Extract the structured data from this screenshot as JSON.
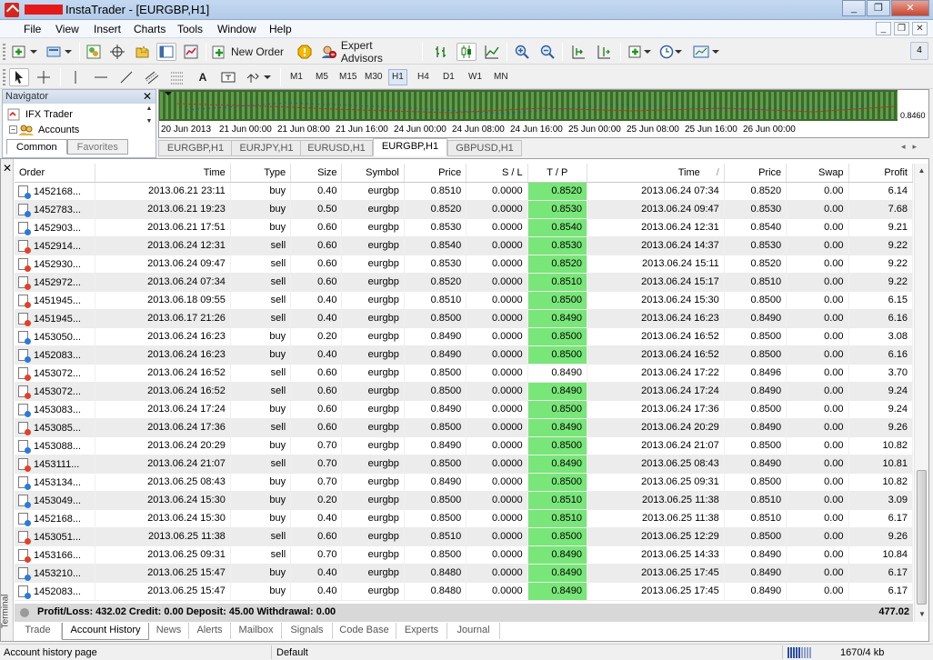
{
  "window": {
    "title": "InstaTrader - [EURGBP,H1]",
    "buttons": [
      "_",
      "❐",
      "✕"
    ]
  },
  "menu": [
    "File",
    "View",
    "Insert",
    "Charts",
    "Tools",
    "Window",
    "Help"
  ],
  "mdi_buttons": [
    "_",
    "❐",
    "✕"
  ],
  "toolbar": {
    "new_order": "New Order",
    "expert_advisors": "Expert Advisors",
    "sidebar_count": "4",
    "text_tool": "A",
    "timeframes": [
      "M1",
      "M5",
      "M15",
      "M30",
      "H1",
      "H4",
      "D1",
      "W1",
      "MN"
    ],
    "active_timeframe": "H1"
  },
  "navigator": {
    "title": "Navigator",
    "tree": [
      "IFX Trader",
      "Accounts"
    ],
    "tabs": [
      "Common",
      "Favorites"
    ]
  },
  "chart": {
    "dates": [
      "20 Jun 2013",
      "21 Jun 00:00",
      "21 Jun 08:00",
      "21 Jun 16:00",
      "24 Jun 00:00",
      "24 Jun 08:00",
      "24 Jun 16:00",
      "25 Jun 00:00",
      "25 Jun 08:00",
      "25 Jun 16:00",
      "26 Jun 00:00"
    ],
    "price_label": "0.8460",
    "tabs": [
      "EURGBP,H1",
      "EURJPY,H1",
      "EURUSD,H1",
      "EURGBP,H1",
      "GBPUSD,H1"
    ],
    "active_tab": 3
  },
  "terminal": {
    "label": "Terminal",
    "columns": [
      "Order",
      "Time",
      "Type",
      "Size",
      "Symbol",
      "Price",
      "S / L",
      "T / P",
      "Time",
      "Price",
      "Swap",
      "Profit"
    ],
    "rows": [
      {
        "order": "1452168...",
        "open_time": "2013.06.21 23:11",
        "type": "buy",
        "size": "0.40",
        "symbol": "eurgbp",
        "open_price": "0.8510",
        "sl": "0.0000",
        "tp": "0.8520",
        "close_time": "2013.06.24 07:34",
        "close_price": "0.8520",
        "swap": "0.00",
        "profit": "6.14",
        "tp_hit": true
      },
      {
        "order": "1452783...",
        "open_time": "2013.06.21 19:23",
        "type": "buy",
        "size": "0.50",
        "symbol": "eurgbp",
        "open_price": "0.8520",
        "sl": "0.0000",
        "tp": "0.8530",
        "close_time": "2013.06.24 09:47",
        "close_price": "0.8530",
        "swap": "0.00",
        "profit": "7.68",
        "tp_hit": true
      },
      {
        "order": "1452903...",
        "open_time": "2013.06.21 17:51",
        "type": "buy",
        "size": "0.60",
        "symbol": "eurgbp",
        "open_price": "0.8530",
        "sl": "0.0000",
        "tp": "0.8540",
        "close_time": "2013.06.24 12:31",
        "close_price": "0.8540",
        "swap": "0.00",
        "profit": "9.21",
        "tp_hit": true
      },
      {
        "order": "1452914...",
        "open_time": "2013.06.24 12:31",
        "type": "sell",
        "size": "0.60",
        "symbol": "eurgbp",
        "open_price": "0.8540",
        "sl": "0.0000",
        "tp": "0.8530",
        "close_time": "2013.06.24 14:37",
        "close_price": "0.8530",
        "swap": "0.00",
        "profit": "9.22",
        "tp_hit": true
      },
      {
        "order": "1452930...",
        "open_time": "2013.06.24 09:47",
        "type": "sell",
        "size": "0.60",
        "symbol": "eurgbp",
        "open_price": "0.8530",
        "sl": "0.0000",
        "tp": "0.8520",
        "close_time": "2013.06.24 15:11",
        "close_price": "0.8520",
        "swap": "0.00",
        "profit": "9.22",
        "tp_hit": true
      },
      {
        "order": "1452972...",
        "open_time": "2013.06.24 07:34",
        "type": "sell",
        "size": "0.60",
        "symbol": "eurgbp",
        "open_price": "0.8520",
        "sl": "0.0000",
        "tp": "0.8510",
        "close_time": "2013.06.24 15:17",
        "close_price": "0.8510",
        "swap": "0.00",
        "profit": "9.22",
        "tp_hit": true
      },
      {
        "order": "1451945...",
        "open_time": "2013.06.18 09:55",
        "type": "sell",
        "size": "0.40",
        "symbol": "eurgbp",
        "open_price": "0.8510",
        "sl": "0.0000",
        "tp": "0.8500",
        "close_time": "2013.06.24 15:30",
        "close_price": "0.8500",
        "swap": "0.00",
        "profit": "6.15",
        "tp_hit": true
      },
      {
        "order": "1451945...",
        "open_time": "2013.06.17 21:26",
        "type": "sell",
        "size": "0.40",
        "symbol": "eurgbp",
        "open_price": "0.8500",
        "sl": "0.0000",
        "tp": "0.8490",
        "close_time": "2013.06.24 16:23",
        "close_price": "0.8490",
        "swap": "0.00",
        "profit": "6.16",
        "tp_hit": true
      },
      {
        "order": "1453050...",
        "open_time": "2013.06.24 16:23",
        "type": "buy",
        "size": "0.20",
        "symbol": "eurgbp",
        "open_price": "0.8490",
        "sl": "0.0000",
        "tp": "0.8500",
        "close_time": "2013.06.24 16:52",
        "close_price": "0.8500",
        "swap": "0.00",
        "profit": "3.08",
        "tp_hit": true
      },
      {
        "order": "1452083...",
        "open_time": "2013.06.24 16:23",
        "type": "buy",
        "size": "0.40",
        "symbol": "eurgbp",
        "open_price": "0.8490",
        "sl": "0.0000",
        "tp": "0.8500",
        "close_time": "2013.06.24 16:52",
        "close_price": "0.8500",
        "swap": "0.00",
        "profit": "6.16",
        "tp_hit": true
      },
      {
        "order": "1453072...",
        "open_time": "2013.06.24 16:52",
        "type": "sell",
        "size": "0.60",
        "symbol": "eurgbp",
        "open_price": "0.8500",
        "sl": "0.0000",
        "tp": "0.8490",
        "close_time": "2013.06.24 17:22",
        "close_price": "0.8496",
        "swap": "0.00",
        "profit": "3.70",
        "tp_hit": false
      },
      {
        "order": "1453072...",
        "open_time": "2013.06.24 16:52",
        "type": "sell",
        "size": "0.60",
        "symbol": "eurgbp",
        "open_price": "0.8500",
        "sl": "0.0000",
        "tp": "0.8490",
        "close_time": "2013.06.24 17:24",
        "close_price": "0.8490",
        "swap": "0.00",
        "profit": "9.24",
        "tp_hit": true
      },
      {
        "order": "1453083...",
        "open_time": "2013.06.24 17:24",
        "type": "buy",
        "size": "0.60",
        "symbol": "eurgbp",
        "open_price": "0.8490",
        "sl": "0.0000",
        "tp": "0.8500",
        "close_time": "2013.06.24 17:36",
        "close_price": "0.8500",
        "swap": "0.00",
        "profit": "9.24",
        "tp_hit": true
      },
      {
        "order": "1453085...",
        "open_time": "2013.06.24 17:36",
        "type": "sell",
        "size": "0.60",
        "symbol": "eurgbp",
        "open_price": "0.8500",
        "sl": "0.0000",
        "tp": "0.8490",
        "close_time": "2013.06.24 20:29",
        "close_price": "0.8490",
        "swap": "0.00",
        "profit": "9.26",
        "tp_hit": true
      },
      {
        "order": "1453088...",
        "open_time": "2013.06.24 20:29",
        "type": "buy",
        "size": "0.70",
        "symbol": "eurgbp",
        "open_price": "0.8490",
        "sl": "0.0000",
        "tp": "0.8500",
        "close_time": "2013.06.24 21:07",
        "close_price": "0.8500",
        "swap": "0.00",
        "profit": "10.82",
        "tp_hit": true
      },
      {
        "order": "1453111...",
        "open_time": "2013.06.24 21:07",
        "type": "sell",
        "size": "0.70",
        "symbol": "eurgbp",
        "open_price": "0.8500",
        "sl": "0.0000",
        "tp": "0.8490",
        "close_time": "2013.06.25 08:43",
        "close_price": "0.8490",
        "swap": "0.00",
        "profit": "10.81",
        "tp_hit": true
      },
      {
        "order": "1453134...",
        "open_time": "2013.06.25 08:43",
        "type": "buy",
        "size": "0.70",
        "symbol": "eurgbp",
        "open_price": "0.8490",
        "sl": "0.0000",
        "tp": "0.8500",
        "close_time": "2013.06.25 09:31",
        "close_price": "0.8500",
        "swap": "0.00",
        "profit": "10.82",
        "tp_hit": true
      },
      {
        "order": "1453049...",
        "open_time": "2013.06.24 15:30",
        "type": "buy",
        "size": "0.20",
        "symbol": "eurgbp",
        "open_price": "0.8500",
        "sl": "0.0000",
        "tp": "0.8510",
        "close_time": "2013.06.25 11:38",
        "close_price": "0.8510",
        "swap": "0.00",
        "profit": "3.09",
        "tp_hit": true
      },
      {
        "order": "1452168...",
        "open_time": "2013.06.24 15:30",
        "type": "buy",
        "size": "0.40",
        "symbol": "eurgbp",
        "open_price": "0.8500",
        "sl": "0.0000",
        "tp": "0.8510",
        "close_time": "2013.06.25 11:38",
        "close_price": "0.8510",
        "swap": "0.00",
        "profit": "6.17",
        "tp_hit": true
      },
      {
        "order": "1453051...",
        "open_time": "2013.06.25 11:38",
        "type": "sell",
        "size": "0.60",
        "symbol": "eurgbp",
        "open_price": "0.8510",
        "sl": "0.0000",
        "tp": "0.8500",
        "close_time": "2013.06.25 12:29",
        "close_price": "0.8500",
        "swap": "0.00",
        "profit": "9.26",
        "tp_hit": true
      },
      {
        "order": "1453166...",
        "open_time": "2013.06.25 09:31",
        "type": "sell",
        "size": "0.70",
        "symbol": "eurgbp",
        "open_price": "0.8500",
        "sl": "0.0000",
        "tp": "0.8490",
        "close_time": "2013.06.25 14:33",
        "close_price": "0.8490",
        "swap": "0.00",
        "profit": "10.84",
        "tp_hit": true
      },
      {
        "order": "1453210...",
        "open_time": "2013.06.25 15:47",
        "type": "buy",
        "size": "0.40",
        "symbol": "eurgbp",
        "open_price": "0.8480",
        "sl": "0.0000",
        "tp": "0.8490",
        "close_time": "2013.06.25 17:45",
        "close_price": "0.8490",
        "swap": "0.00",
        "profit": "6.17",
        "tp_hit": true
      },
      {
        "order": "1452083...",
        "open_time": "2013.06.25 15:47",
        "type": "buy",
        "size": "0.40",
        "symbol": "eurgbp",
        "open_price": "0.8480",
        "sl": "0.0000",
        "tp": "0.8490",
        "close_time": "2013.06.25 17:45",
        "close_price": "0.8490",
        "swap": "0.00",
        "profit": "6.17",
        "tp_hit": true
      }
    ],
    "summary": "Profit/Loss: 432.02  Credit: 0.00  Deposit: 45.00  Withdrawal: 0.00",
    "summary_total": "477.02",
    "tabs": [
      "Trade",
      "Account History",
      "News",
      "Alerts",
      "Mailbox",
      "Signals",
      "Code Base",
      "Experts",
      "Journal"
    ],
    "active_tab": 1
  },
  "statusbar": {
    "hint": "Account history page",
    "profile": "Default",
    "traffic": "1670/4 kb"
  },
  "colors": {
    "tp_hit": "#78e678",
    "buy_dot": "#2a7ad8",
    "sell_dot": "#e2402a",
    "stripe": "#ececec"
  }
}
